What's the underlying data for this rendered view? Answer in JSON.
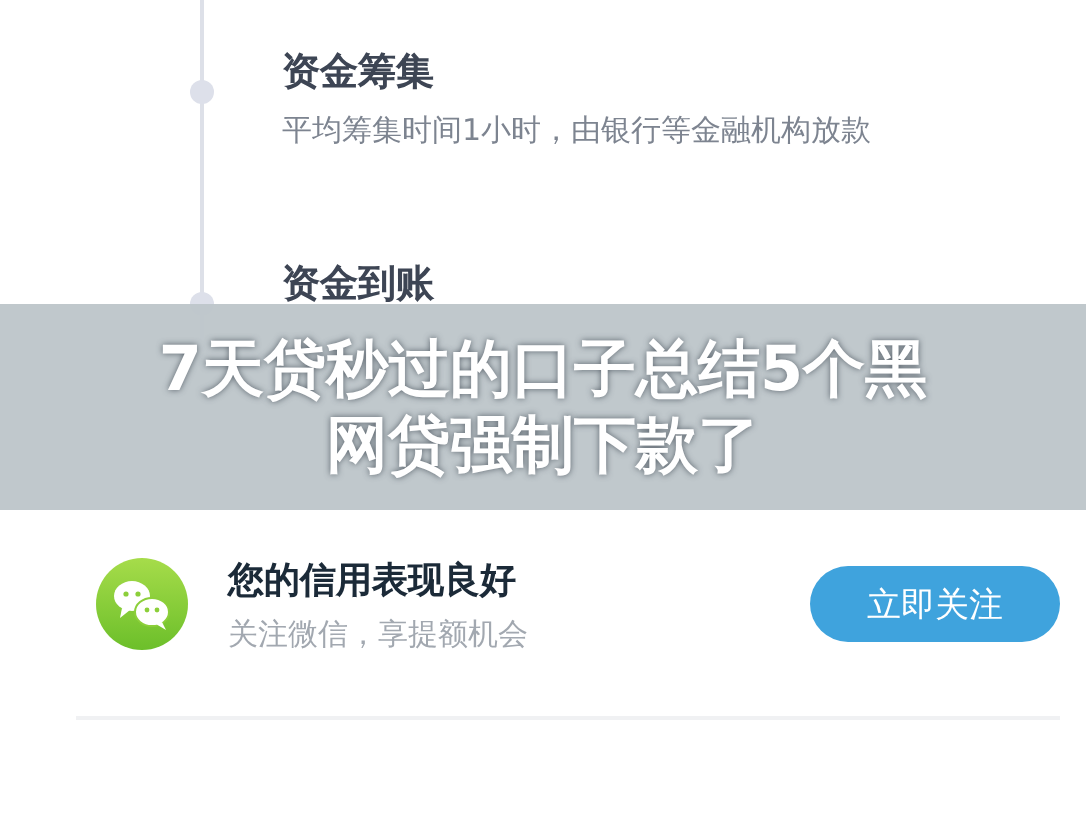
{
  "steps": [
    {
      "title": "资金筹集",
      "description": "平均筹集时间1小时，由银行等金融机构放款"
    },
    {
      "title": "资金到账"
    }
  ],
  "overlay_title": "7天贷秒过的口子总结5个黑网贷强制下款了",
  "follow_card": {
    "title": "您的信用表现良好",
    "subtitle": "关注微信，享提额机会",
    "button": "立即关注"
  }
}
